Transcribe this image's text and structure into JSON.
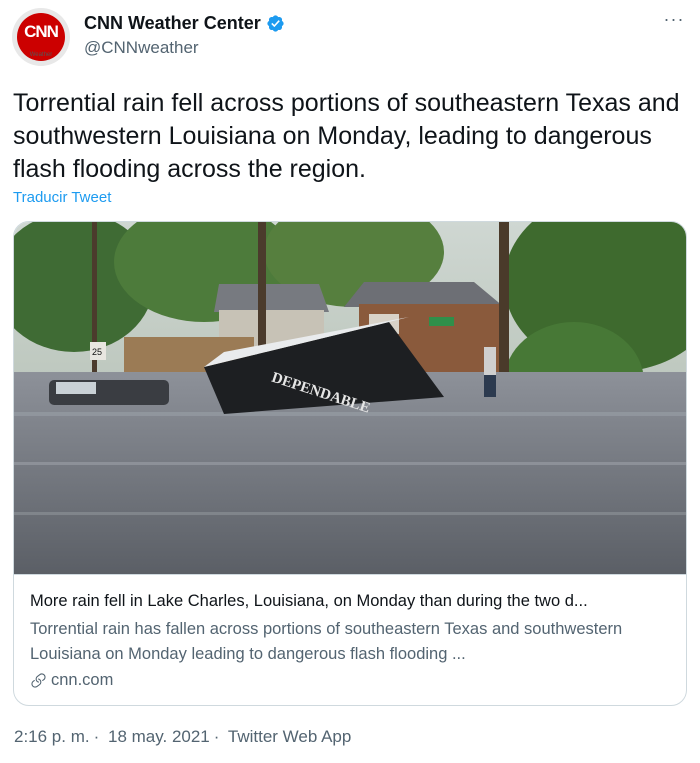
{
  "author": {
    "avatar_logo": "CNN",
    "avatar_sub": "Weather",
    "name": "CNN Weather Center",
    "handle": "@CNNweather",
    "verified_icon": "verified-badge-icon"
  },
  "more_label": "···",
  "tweet": {
    "text": "Torrential rain fell across portions of southeastern Texas and southwestern Louisiana on Monday, leading to dangerous flash flooding across the region.",
    "translate_label": "Traducir Tweet"
  },
  "card": {
    "title": "More rain fell in Lake Charles, Louisiana, on Monday than during the two d...",
    "description": "Torrential rain has fallen across portions of southeastern Texas and southwestern Louisiana on Monday leading to dangerous flash flooding ...",
    "domain": "cnn.com",
    "photo": {
      "trailer_text": "DEPENDABLE",
      "sign_text": "25"
    }
  },
  "meta": {
    "time": "2:16 p. m.",
    "separator": "·",
    "date": "18 may. 2021",
    "source": "Twitter Web App"
  },
  "colors": {
    "link": "#1d9bf0",
    "text": "#0f1419",
    "secondary": "#536471",
    "cnn_red": "#cc0000"
  }
}
